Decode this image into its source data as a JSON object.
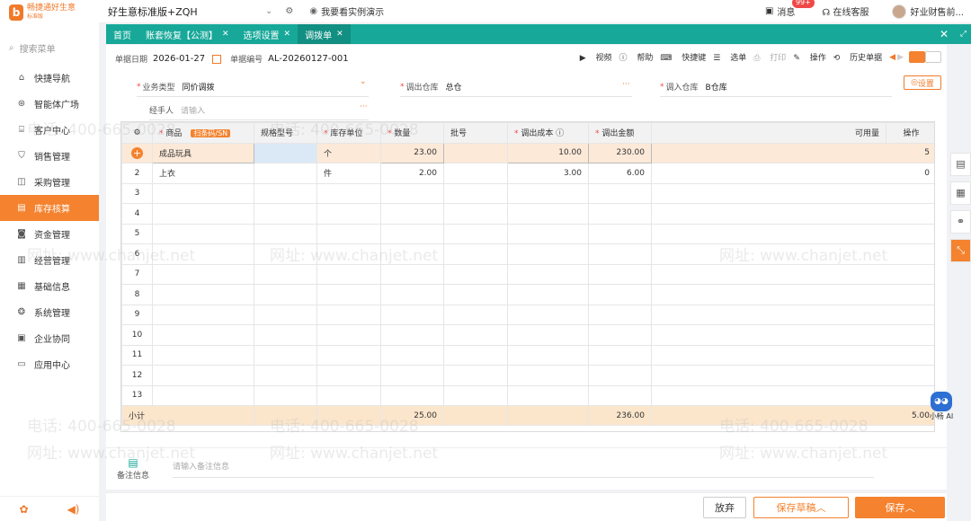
{
  "app": {
    "logo_text": "畅捷通好生意",
    "logo_sub": "标准版",
    "account": "好生意标准版+ZQH",
    "demo": "我要看实例演示",
    "messages": "消息",
    "msg_badge": "99+",
    "service": "在线客服",
    "user": "好业财售前..."
  },
  "sidebar": {
    "search_placeholder": "搜索菜单",
    "items": [
      {
        "label": "快捷导航"
      },
      {
        "label": "智能体广场"
      },
      {
        "label": "客户中心"
      },
      {
        "label": "销售管理"
      },
      {
        "label": "采购管理"
      },
      {
        "label": "库存核算"
      },
      {
        "label": "资金管理"
      },
      {
        "label": "经营管理"
      },
      {
        "label": "基础信息"
      },
      {
        "label": "系统管理"
      },
      {
        "label": "企业协同"
      },
      {
        "label": "应用中心"
      }
    ]
  },
  "tabs": [
    {
      "label": "首页"
    },
    {
      "label": "账套恢复【公测】"
    },
    {
      "label": "选项设置"
    },
    {
      "label": "调拨单"
    }
  ],
  "header": {
    "date_label": "单据日期",
    "date": "2026-01-27",
    "no_label": "单据编号",
    "no": "AL-20260127-001"
  },
  "toolbar": {
    "video": "视频",
    "help": "帮助",
    "shortcut": "快捷键",
    "pick": "选单",
    "print": "打印",
    "operate": "操作",
    "history": "历史单据"
  },
  "form": {
    "biz_type_label": "业务类型",
    "biz_type": "同价调拨",
    "out_wh_label": "调出仓库",
    "out_wh": "总仓",
    "in_wh_label": "调入仓库",
    "in_wh": "B仓库",
    "handler_label": "经手人",
    "handler_placeholder": "请输入",
    "settings": "设置"
  },
  "grid": {
    "columns": [
      "商品",
      "规格型号",
      "库存单位",
      "数量",
      "批号",
      "调出成本",
      "调出金额",
      "可用量",
      "操作"
    ],
    "scan_tag": "扫条码/SN",
    "rows": [
      {
        "no": "",
        "product": "成品玩具",
        "spec": "",
        "unit": "个",
        "qty": "23.00",
        "batch": "",
        "cost": "10.00",
        "amount": "230.00",
        "avail": "5"
      },
      {
        "no": "2",
        "product": "上衣",
        "spec": "",
        "unit": "件",
        "qty": "2.00",
        "batch": "",
        "cost": "3.00",
        "amount": "6.00",
        "avail": "0"
      },
      {
        "no": "3"
      },
      {
        "no": "4"
      },
      {
        "no": "5"
      },
      {
        "no": "6"
      },
      {
        "no": "7"
      },
      {
        "no": "8"
      },
      {
        "no": "9"
      },
      {
        "no": "10"
      },
      {
        "no": "11"
      },
      {
        "no": "12"
      },
      {
        "no": "13"
      }
    ],
    "summary": {
      "label": "小计",
      "qty": "25.00",
      "amount": "236.00",
      "avail": "5.00"
    }
  },
  "remark": {
    "label": "备注信息",
    "placeholder": "请输入备注信息"
  },
  "footer": {
    "abandon": "放弃",
    "draft": "保存草稿",
    "save": "保存"
  },
  "ai": {
    "label": "小畅 AI"
  },
  "watermark": {
    "phone": "电话: 400-665-0028",
    "site": "网址: www.chanjet.net"
  },
  "colors": {
    "accent": "#f4822e",
    "teal": "#17a899"
  }
}
